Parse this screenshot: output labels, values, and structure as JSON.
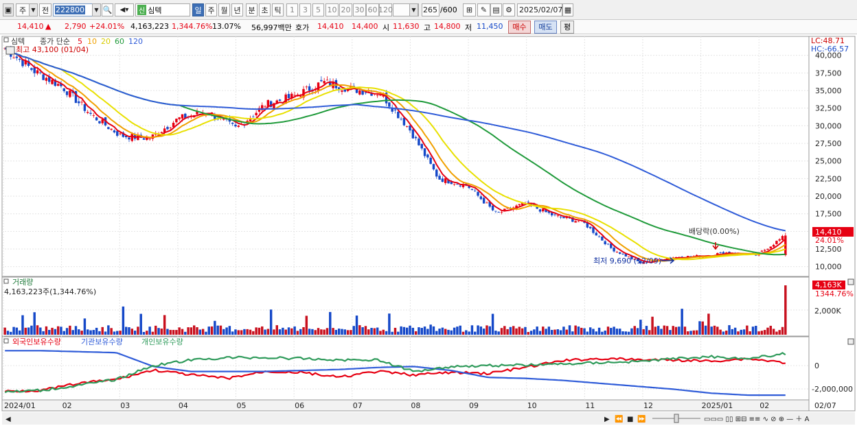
{
  "toolbar": {
    "mode": "주",
    "prev_label": "전",
    "code": "222800",
    "stock_badge": "신",
    "stock_name": "심텍",
    "periods": [
      "일",
      "주",
      "월",
      "년",
      "분",
      "초",
      "틱"
    ],
    "minutes": [
      "1",
      "3",
      "5",
      "10",
      "20",
      "30",
      "60",
      "120"
    ],
    "count": "265",
    "count_total": "/600",
    "date": "2025/02/07"
  },
  "quote": {
    "price": "14,410",
    "change_arrow": "▲",
    "change": "2,790",
    "change_pct": "+24.01%",
    "volume": "4,163,223",
    "volume_pct": "1,344.76%",
    "turnover": "13.07%",
    "amount": "56,997백만",
    "hoga_label": "호가",
    "ask": "14,410",
    "bid": "14,400",
    "open_label": "시",
    "open": "11,630",
    "high_label": "고",
    "high": "14,800",
    "low_label": "저",
    "low": "11,450",
    "buy_label": "매수",
    "sell_label": "매도",
    "eval_label": "평"
  },
  "price_pane": {
    "name": "심텍",
    "ma_legend_title": "종가 단순",
    "ma_periods": [
      "5",
      "10",
      "20",
      "60",
      "120"
    ],
    "ma_colors": [
      "#e60012",
      "#f0a000",
      "#e8e000",
      "#1f9a3a",
      "#2e5bd8"
    ],
    "high_note": "최고 43,100 (01/04)",
    "low_note": "최저 9,690 (12/09)",
    "dividend_note": "배당락(0.00%)",
    "lc": "LC:48.71",
    "hc": "HC:-66.57",
    "last_price_label": "14,410",
    "last_pct_label": "24.01%",
    "y_ticks": [
      "40,000",
      "37,500",
      "35,000",
      "32,500",
      "30,000",
      "27,500",
      "25,000",
      "22,500",
      "20,000",
      "17,500",
      "15,000",
      "12,500",
      "10,000"
    ]
  },
  "volume_pane": {
    "title": "거래량",
    "value": "4,163,223주(1,344.76%)",
    "last_label": "4,163K",
    "last_pct": "1344.76%",
    "y_tick": "2,000K"
  },
  "flow_pane": {
    "legend": [
      "외국인보유수량",
      "기관보유수량",
      "개인보유수량"
    ],
    "colors": [
      "#e60012",
      "#2e5bd8",
      "#2e9a5a"
    ],
    "y_ticks": [
      "0",
      "-2,000,000"
    ]
  },
  "x_axis": {
    "labels": [
      "2024/01",
      "02",
      "03",
      "04",
      "05",
      "06",
      "07",
      "08",
      "09",
      "10",
      "11",
      "12",
      "2025/01",
      "02"
    ],
    "right_label": "02/07"
  },
  "chart_data": {
    "type": "candlestick",
    "title": "심텍",
    "period": "daily",
    "x_range": [
      "2024/01",
      "2025/02/07"
    ],
    "ylim": [
      9000,
      42500
    ],
    "price_path": [
      {
        "x": "2024/01",
        "close": 41000
      },
      {
        "x": "2024/01b",
        "close": 37800
      },
      {
        "x": "2024/02",
        "close": 35500
      },
      {
        "x": "2024/02b",
        "close": 31500
      },
      {
        "x": "2024/03",
        "close": 28600
      },
      {
        "x": "2024/03b",
        "close": 28200
      },
      {
        "x": "2024/04",
        "close": 31000
      },
      {
        "x": "2024/04b",
        "close": 32000
      },
      {
        "x": "2024/05",
        "close": 29600
      },
      {
        "x": "2024/05b",
        "close": 33000
      },
      {
        "x": "2024/06",
        "close": 34200
      },
      {
        "x": "2024/06b",
        "close": 36200
      },
      {
        "x": "2024/07",
        "close": 35200
      },
      {
        "x": "2024/07b",
        "close": 34600
      },
      {
        "x": "2024/08",
        "close": 29500
      },
      {
        "x": "2024/08b",
        "close": 22500
      },
      {
        "x": "2024/09",
        "close": 21500
      },
      {
        "x": "2024/09b",
        "close": 17500
      },
      {
        "x": "2024/10",
        "close": 19000
      },
      {
        "x": "2024/10b",
        "close": 17200
      },
      {
        "x": "2024/11",
        "close": 16300
      },
      {
        "x": "2024/11b",
        "close": 12500
      },
      {
        "x": "2024/12",
        "close": 10500
      },
      {
        "x": "2024/12b",
        "close": 11300
      },
      {
        "x": "2025/01",
        "close": 11500
      },
      {
        "x": "2025/01b",
        "close": 12000
      },
      {
        "x": "2025/02",
        "close": 11620
      },
      {
        "x": "2025/02/07",
        "close": 14410
      }
    ]
  }
}
